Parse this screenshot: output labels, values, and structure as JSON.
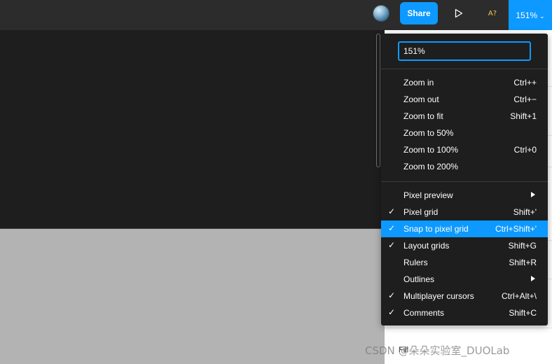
{
  "topbar": {
    "share_label": "Share",
    "play_icon": "play-icon",
    "font_check_label": "A?",
    "zoom_label": "151%",
    "zoom_chevron": "⌄"
  },
  "menu": {
    "zoom_input_value": "151%",
    "group1": [
      {
        "label": "Zoom in",
        "shortcut": "Ctrl++"
      },
      {
        "label": "Zoom out",
        "shortcut": "Ctrl+−"
      },
      {
        "label": "Zoom to fit",
        "shortcut": "Shift+1"
      },
      {
        "label": "Zoom to 50%",
        "shortcut": ""
      },
      {
        "label": "Zoom to 100%",
        "shortcut": "Ctrl+0"
      },
      {
        "label": "Zoom to 200%",
        "shortcut": ""
      }
    ],
    "group2": [
      {
        "label": "Pixel preview",
        "shortcut": "",
        "submenu": true,
        "checked": false
      },
      {
        "label": "Pixel grid",
        "shortcut": "Shift+'",
        "checked": true
      },
      {
        "label": "Snap to pixel grid",
        "shortcut": "Ctrl+Shift+'",
        "checked": true,
        "highlighted": true
      },
      {
        "label": "Layout grids",
        "shortcut": "Shift+G",
        "checked": true
      },
      {
        "label": "Rulers",
        "shortcut": "Shift+R",
        "checked": false
      },
      {
        "label": "Outlines",
        "shortcut": "",
        "submenu": true,
        "checked": false
      },
      {
        "label": "Multiplayer cursors",
        "shortcut": "Ctrl+Alt+\\",
        "checked": true
      },
      {
        "label": "Comments",
        "shortcut": "Shift+C",
        "checked": true
      }
    ],
    "check_glyph": "✓"
  },
  "right_panel": {
    "bottom_text": "Fill"
  },
  "watermark": "CSDN @朵朵实验室_DUOLab",
  "colors": {
    "accent": "#0d99ff",
    "menu_bg": "#1e1e1e",
    "topbar_bg": "#2c2c2c"
  }
}
